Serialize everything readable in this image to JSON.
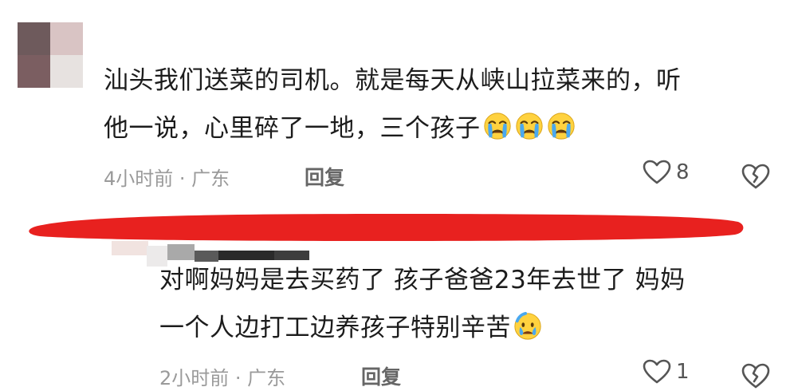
{
  "comments": [
    {
      "line1": "汕头我们送菜的司机。就是每天从峡山拉菜来的，听",
      "line2": "他一说，心里碎了一地，三个孩子",
      "meta": "4小时前 · 广东",
      "reply_label": "回复",
      "like_count": "8",
      "emoji": "crying-face"
    },
    {
      "line1": "对啊妈妈是去买药了 孩子爸爸23年去世了 妈妈",
      "line2": "一个人边打工边养孩子特别辛苦",
      "meta": "2小时前 · 广东",
      "reply_label": "回复",
      "like_count": "1",
      "emoji": "sad-sweat-face"
    }
  ],
  "icons": {
    "like": "heart-outline-icon",
    "dislike": "broken-heart-icon"
  },
  "colors": {
    "text": "#1c1c1c",
    "meta": "#9a9a9a",
    "annotation_stroke": "#e8211f"
  }
}
